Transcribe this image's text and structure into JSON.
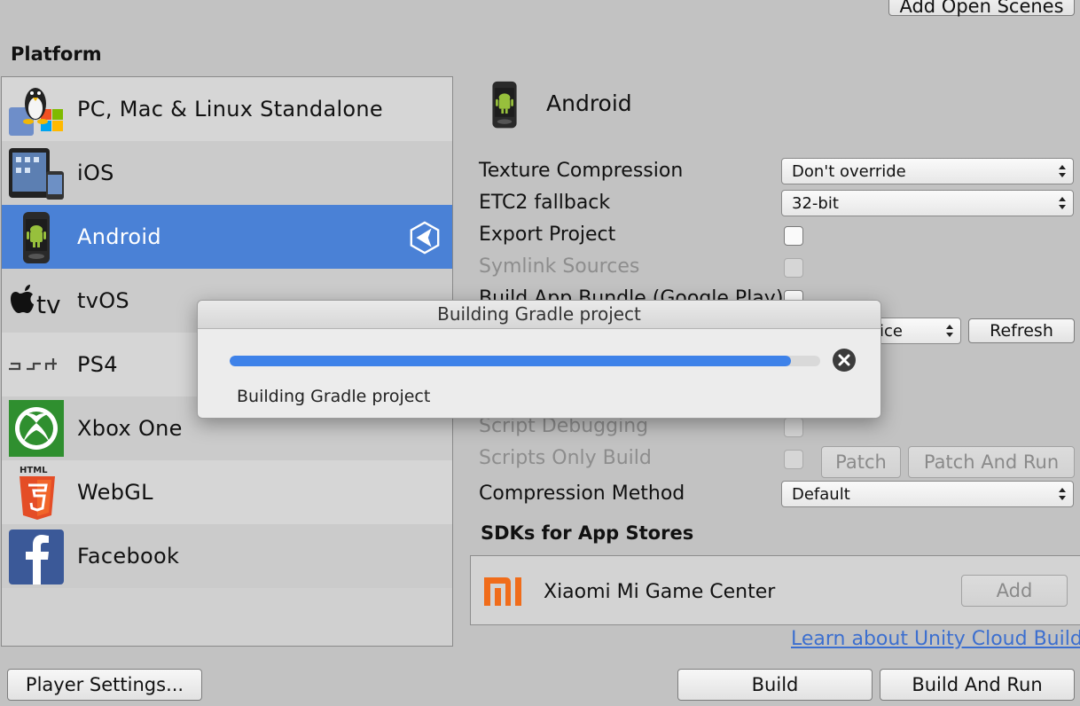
{
  "toolbar": {
    "add_open_scenes_label": "Add Open Scenes"
  },
  "platform_section": {
    "title": "Platform",
    "items": [
      {
        "label": "PC, Mac & Linux Standalone",
        "icon": "standalone-icon"
      },
      {
        "label": "iOS",
        "icon": "ios-devices-icon"
      },
      {
        "label": "Android",
        "icon": "android-phone-icon",
        "selected": true,
        "badge_icon": "unity-logo-icon"
      },
      {
        "label": "tvOS",
        "icon": "apple-tv-icon"
      },
      {
        "label": "PS4",
        "icon": "ps4-logo-icon"
      },
      {
        "label": "Xbox One",
        "icon": "xbox-logo-icon"
      },
      {
        "label": "WebGL",
        "icon": "html5-icon"
      },
      {
        "label": "Facebook",
        "icon": "facebook-icon"
      }
    ]
  },
  "settings": {
    "platform_title": "Android",
    "texture_compression": {
      "label": "Texture Compression",
      "value": "Don't override"
    },
    "etc2_fallback": {
      "label": "ETC2 fallback",
      "value": "32-bit"
    },
    "export_project": {
      "label": "Export Project"
    },
    "symlink_sources": {
      "label": "Symlink Sources"
    },
    "build_app_bundle": {
      "label": "Build App Bundle (Google Play)"
    },
    "run_device": {
      "value": "ice",
      "refresh_label": "Refresh"
    },
    "script_debugging": {
      "label": "Script Debugging"
    },
    "scripts_only_build": {
      "label": "Scripts Only Build",
      "patch_label": "Patch",
      "patch_and_run_label": "Patch And Run"
    },
    "compression_method": {
      "label": "Compression Method",
      "value": "Default"
    }
  },
  "sdk_section": {
    "title": "SDKs for App Stores",
    "items": [
      {
        "label": "Xiaomi Mi Game Center",
        "add_label": "Add",
        "icon": "xiaomi-logo-icon"
      }
    ]
  },
  "cloud_build_link": "Learn about Unity Cloud Build",
  "footer": {
    "player_settings_label": "Player Settings...",
    "build_label": "Build",
    "build_and_run_label": "Build And Run"
  },
  "progress_dialog": {
    "title": "Building Gradle project",
    "status": "Building Gradle project",
    "progress": 0.95
  },
  "colors": {
    "selection": "#4a81d6",
    "progress": "#3e82e9",
    "link": "#3c6fcf",
    "xiaomi": "#f06c1a",
    "xbox": "#2f8f2f",
    "html5": "#e44d26",
    "facebook": "#3b5998"
  }
}
